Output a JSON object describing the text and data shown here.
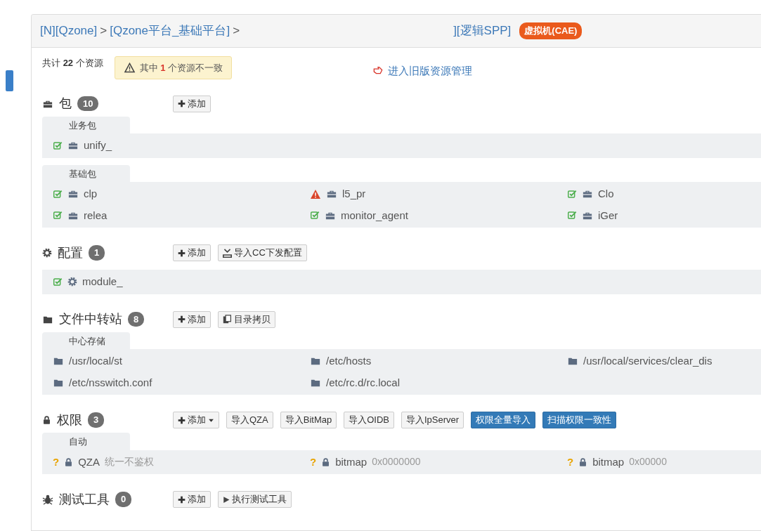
{
  "breadcrumb": {
    "parts": [
      "[N][Qzone]",
      ">",
      "[Qzone平台_基础平台]",
      ">",
      "][逻辑SPP]"
    ],
    "tag": "虚拟机(CAE)"
  },
  "summary": {
    "total": "共计 **22** 个资源",
    "alert": "其中 **1** 个资源不一致",
    "link": "进入旧版资源管理"
  },
  "sections": [
    {
      "kind": "package",
      "title": "包",
      "count": "10",
      "buttons": [
        {
          "label": "添加",
          "kind": "add",
          "primary": false
        }
      ],
      "groups": [
        {
          "label": "业务包",
          "items": [
            {
              "kind": "ok",
              "name": "unify_"
            }
          ]
        },
        {
          "label": "基础包",
          "items": [
            {
              "kind": "ok",
              "name": "clp"
            },
            {
              "kind": "warn",
              "name": "l5_pr"
            },
            {
              "kind": "ok",
              "name": "Clo"
            },
            {
              "kind": "ok",
              "name": "relea"
            },
            {
              "kind": "ok",
              "name": "monitor_agent"
            },
            {
              "kind": "ok",
              "name": "iGer"
            }
          ]
        }
      ]
    },
    {
      "kind": "config",
      "title": "配置",
      "count": "1",
      "buttons": [
        {
          "label": "添加",
          "kind": "add",
          "primary": false
        },
        {
          "label": "导入CC下发配置",
          "kind": "import",
          "primary": false
        }
      ],
      "groups": [
        {
          "items": [
            {
              "kind": "ok",
              "name": "module_"
            }
          ]
        }
      ]
    },
    {
      "kind": "file",
      "title": "文件中转站",
      "count": "8",
      "buttons": [
        {
          "label": "添加",
          "kind": "add",
          "primary": false
        },
        {
          "label": "目录拷贝",
          "kind": "copy",
          "primary": false
        }
      ],
      "groups": [
        {
          "label": "中心存储",
          "items": [
            {
              "name": "/usr/local/st"
            },
            {
              "name": "/etc/hosts"
            },
            {
              "name": "/usr/local/services/clear_dis"
            },
            {
              "name": "/etc/nsswitch.conf"
            },
            {
              "name": "/etc/rc.d/rc.local"
            }
          ]
        }
      ]
    },
    {
      "kind": "permission",
      "title": "权限",
      "count": "3",
      "buttons": [
        {
          "label": "添加",
          "kind": "add-menu",
          "primary": false
        },
        {
          "label": "导入QZA",
          "kind": "plain",
          "primary": false
        },
        {
          "label": "导入BitMap",
          "kind": "plain",
          "primary": false
        },
        {
          "label": "导入OIDB",
          "kind": "plain",
          "primary": false
        },
        {
          "label": "导入IpServer",
          "kind": "plain",
          "primary": false
        },
        {
          "label": "权限全量导入",
          "kind": "plain",
          "primary": true
        },
        {
          "label": "扫描权限一致性",
          "kind": "plain",
          "primary": true
        }
      ],
      "groups": [
        {
          "label": "自动",
          "items": [
            {
              "flag": "?",
              "name": "QZA",
              "detail": "统一不鉴权"
            },
            {
              "flag": "?",
              "name": "bitmap",
              "detail": "0x0000000"
            },
            {
              "flag": "?",
              "name": "bitmap",
              "detail": "0x00000"
            }
          ]
        }
      ]
    },
    {
      "kind": "test",
      "title": "测试工具",
      "count": "0",
      "buttons": [
        {
          "label": "添加",
          "kind": "add",
          "primary": false
        },
        {
          "label": "执行测试工具",
          "kind": "run",
          "primary": false
        }
      ]
    }
  ]
}
